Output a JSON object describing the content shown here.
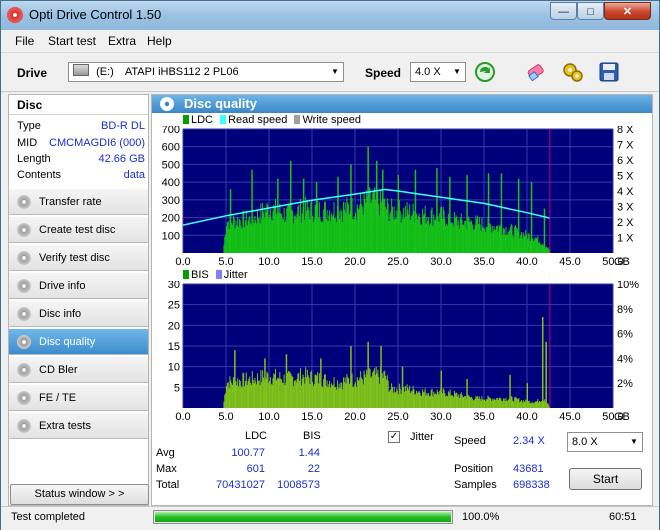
{
  "window": {
    "title": "Opti Drive Control 1.50",
    "min_glyph": "—",
    "max_glyph": "□",
    "close_glyph": "✕"
  },
  "menu": [
    "File",
    "Start test",
    "Extra",
    "Help"
  ],
  "toolbar": {
    "drive_label": "Drive",
    "drive_letter": "(E:)",
    "drive_name": "ATAPI iHBS112   2 PL06",
    "speed_label": "Speed",
    "speed_value": "4.0 X"
  },
  "disc": {
    "header": "Disc",
    "rows": [
      {
        "key": "Type",
        "value": "BD-R DL"
      },
      {
        "key": "MID",
        "value": "CMCMAGDI6 (000)"
      },
      {
        "key": "Length",
        "value": "42.66 GB"
      },
      {
        "key": "Contents",
        "value": "data"
      }
    ]
  },
  "nav": [
    {
      "label": "Transfer rate",
      "active": false
    },
    {
      "label": "Create test disc",
      "active": false
    },
    {
      "label": "Verify test disc",
      "active": false
    },
    {
      "label": "Drive info",
      "active": false
    },
    {
      "label": "Disc info",
      "active": false
    },
    {
      "label": "Disc quality",
      "active": true
    },
    {
      "label": "CD Bler",
      "active": false
    },
    {
      "label": "FE / TE",
      "active": false
    },
    {
      "label": "Extra tests",
      "active": false
    }
  ],
  "status_window_label": "Status window > >",
  "panel_title": "Disc quality",
  "chart_data": [
    {
      "type": "area",
      "legend": [
        "LDC",
        "Read speed",
        "Write speed"
      ],
      "colors": {
        "LDC": "#00c000",
        "Read speed": "#40ffff",
        "Write speed": "#a0a0a0",
        "background": "#00007a",
        "marker": "#c00080"
      },
      "x_unit": "GB",
      "x_ticks": [
        "0.0",
        "5.0",
        "10.0",
        "15.0",
        "20.0",
        "25.0",
        "30.0",
        "35.0",
        "40.0",
        "45.0",
        "50.0"
      ],
      "xlim": [
        0,
        50
      ],
      "ylim_left": [
        0,
        700
      ],
      "y_ticks_left": [
        "100",
        "200",
        "300",
        "400",
        "500",
        "600",
        "700"
      ],
      "ylim_right": [
        0,
        8
      ],
      "y_ticks_right": [
        "1 X",
        "2 X",
        "3 X",
        "4 X",
        "5 X",
        "6 X",
        "7 X",
        "8 X"
      ],
      "grid": true,
      "end_marker_x": 42.66,
      "ldc_envelope": {
        "x": [
          0,
          4.6,
          5,
          8,
          10,
          12,
          14,
          16,
          18,
          20,
          22,
          23,
          24,
          26,
          28,
          30,
          32,
          34,
          36,
          38,
          40,
          41,
          42,
          42.66
        ],
        "y": [
          0,
          0,
          230,
          250,
          330,
          280,
          320,
          310,
          320,
          330,
          390,
          360,
          310,
          300,
          280,
          270,
          230,
          220,
          200,
          170,
          130,
          110,
          60,
          20
        ]
      },
      "ldc_spikes": {
        "x": [
          5.5,
          8,
          11,
          12.5,
          14,
          15.5,
          18,
          19.5,
          21.5,
          22.5,
          23.2,
          25,
          27,
          29.5,
          31,
          33,
          35.5,
          37,
          39,
          40.5,
          42
        ],
        "y": [
          360,
          470,
          420,
          520,
          420,
          400,
          430,
          500,
          600,
          520,
          470,
          440,
          470,
          480,
          430,
          440,
          450,
          450,
          420,
          400,
          250
        ]
      },
      "read_speed": {
        "x": [
          0,
          5,
          10,
          15,
          20,
          23.5,
          25,
          30,
          35,
          40,
          42.66
        ],
        "y": [
          1.8,
          2.4,
          2.9,
          3.4,
          3.8,
          4.1,
          4.0,
          3.6,
          3.2,
          2.6,
          2.25
        ]
      }
    },
    {
      "type": "area",
      "legend": [
        "BIS",
        "Jitter"
      ],
      "colors": {
        "BIS": "#00c000",
        "Jitter": "#8080ff",
        "background": "#00007a",
        "marker": "#c00080"
      },
      "x_unit": "GB",
      "x_ticks": [
        "0.0",
        "5.0",
        "10.0",
        "15.0",
        "20.0",
        "25.0",
        "30.0",
        "35.0",
        "40.0",
        "45.0",
        "50.0"
      ],
      "xlim": [
        0,
        50
      ],
      "ylim_left": [
        0,
        30
      ],
      "y_ticks_left": [
        "5",
        "10",
        "15",
        "20",
        "25",
        "30"
      ],
      "ylim_right": [
        0,
        10
      ],
      "y_ticks_right": [
        "2%",
        "4%",
        "6%",
        "8%",
        "10%"
      ],
      "grid": true,
      "end_marker_x": 42.66,
      "bis_envelope": {
        "x": [
          0,
          4.6,
          5,
          8,
          10,
          12,
          14,
          16,
          18,
          20,
          22,
          23.5,
          24,
          26,
          28,
          30,
          32,
          34,
          36,
          38,
          40,
          41,
          42,
          42.66
        ],
        "y": [
          0,
          0,
          8,
          9,
          10,
          9,
          10,
          9,
          8,
          9,
          10,
          10,
          6,
          6,
          5,
          5,
          4,
          3,
          3,
          3,
          2,
          2,
          3,
          0
        ]
      },
      "bis_spikes": {
        "x": [
          6,
          9.5,
          12,
          16,
          19.5,
          21.5,
          23,
          25.5,
          30,
          33,
          38,
          40,
          41.8,
          42.2
        ],
        "y": [
          14,
          12,
          13,
          12,
          15,
          16,
          15,
          10,
          9,
          7,
          8,
          6,
          22,
          16
        ]
      }
    }
  ],
  "stats": {
    "col_ldc": "LDC",
    "col_bis": "BIS",
    "rows": [
      {
        "label": "Avg",
        "ldc": "100.77",
        "bis": "1.44"
      },
      {
        "label": "Max",
        "ldc": "601",
        "bis": "22"
      },
      {
        "label": "Total",
        "ldc": "70431027",
        "bis": "1008573"
      }
    ],
    "jitter_label": "Jitter",
    "jitter_checked": true,
    "speed_label": "Speed",
    "speed_value": "2.34 X",
    "speed_select": "8.0 X",
    "position_label": "Position",
    "position_value": "43681",
    "samples_label": "Samples",
    "samples_value": "698338",
    "start_label": "Start"
  },
  "statusbar": {
    "text": "Test completed",
    "progress": 1.0,
    "progress_text": "100.0%",
    "time": "60:51"
  }
}
